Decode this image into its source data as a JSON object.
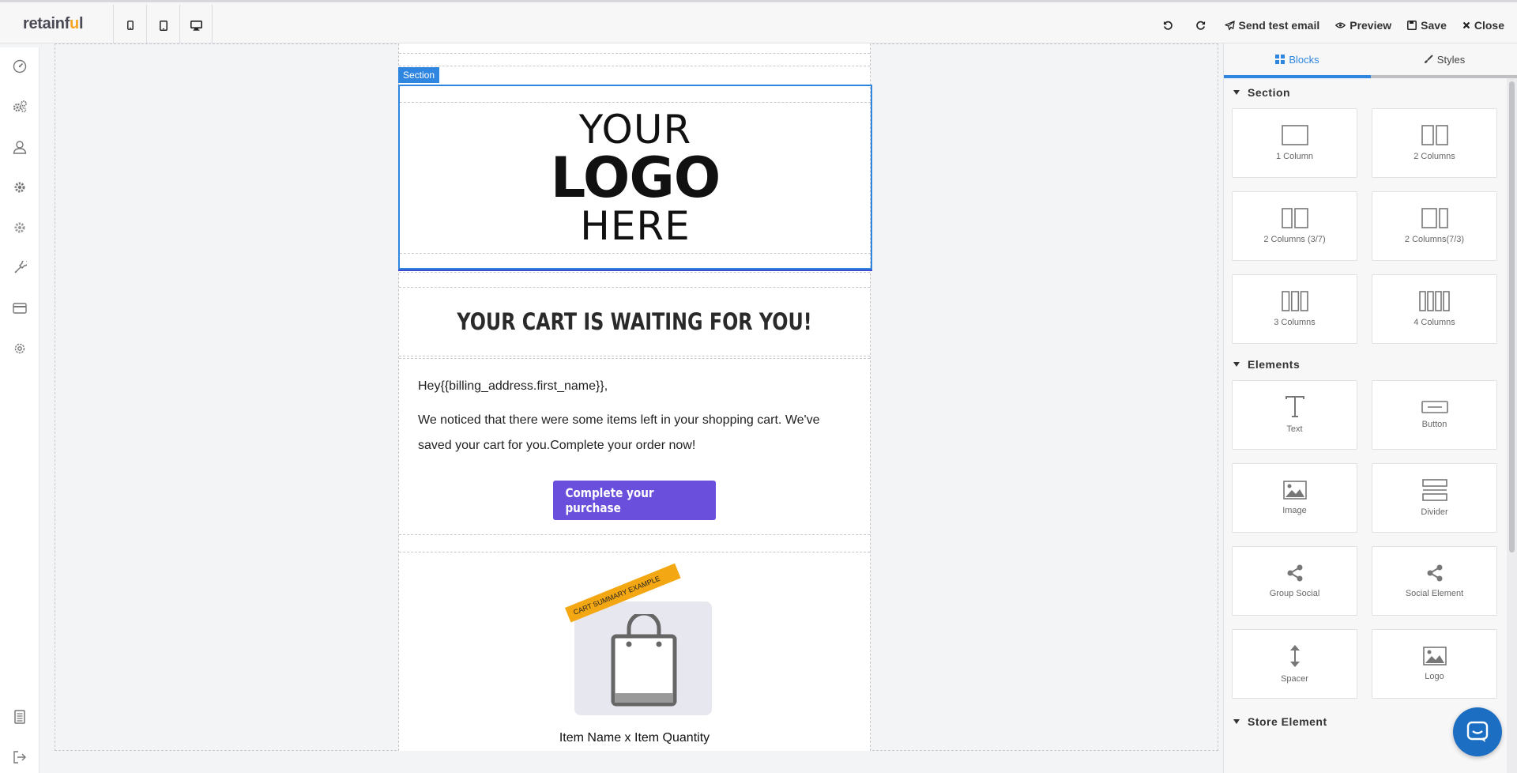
{
  "app": {
    "logo_text_pre": "retainf",
    "logo_text_accent": "u",
    "logo_text_post": "l"
  },
  "toolbar": {
    "devices": [
      "mobile-icon",
      "tablet-icon",
      "desktop-icon"
    ],
    "undo_icon": "undo-icon",
    "redo_icon": "redo-icon",
    "send_test_label": "Send test email",
    "preview_label": "Preview",
    "save_label": "Save",
    "close_label": "Close"
  },
  "sidebar": {
    "items": [
      "dashboard-icon",
      "automation-icon",
      "user-icon",
      "settings-icon",
      "cog-icon",
      "tools-icon",
      "billing-icon",
      "preferences-icon",
      "document-icon",
      "logout-icon"
    ]
  },
  "email": {
    "section_badge": "Section",
    "logo": {
      "line1": "YOUR",
      "line2": "LOGO",
      "line3": "HERE"
    },
    "heading": "YOUR CART IS WAITING FOR YOU!",
    "greeting": "Hey{{billing_address.first_name}},",
    "paragraph": "We noticed that there were some items left in your shopping cart. We've saved your cart for you.Complete your order now!",
    "cta_label": "Complete your purchase",
    "cart_ribbon": "CART SUMMARY EXAMPLE",
    "item_name": "Item Name x Item Quantity"
  },
  "panel": {
    "tabs": [
      {
        "label": "Blocks",
        "icon": "grid-icon",
        "active": true
      },
      {
        "label": "Styles",
        "icon": "brush-icon",
        "active": false
      }
    ],
    "section_title": "Section",
    "section_blocks": [
      {
        "label": "1 Column",
        "icon": "one-column-icon"
      },
      {
        "label": "2 Columns",
        "icon": "two-columns-icon"
      },
      {
        "label": "2 Columns (3/7)",
        "icon": "two-columns-37-icon"
      },
      {
        "label": "2 Columns(7/3)",
        "icon": "two-columns-73-icon"
      },
      {
        "label": "3 Columns",
        "icon": "three-columns-icon"
      },
      {
        "label": "4 Columns",
        "icon": "four-columns-icon"
      }
    ],
    "elements_title": "Elements",
    "element_blocks": [
      {
        "label": "Text",
        "icon": "text-icon"
      },
      {
        "label": "Button",
        "icon": "button-icon"
      },
      {
        "label": "Image",
        "icon": "image-icon"
      },
      {
        "label": "Divider",
        "icon": "divider-icon"
      },
      {
        "label": "Group Social",
        "icon": "share-icon"
      },
      {
        "label": "Social Element",
        "icon": "share-icon"
      },
      {
        "label": "Spacer",
        "icon": "spacer-icon"
      },
      {
        "label": "Logo",
        "icon": "image-icon"
      }
    ],
    "store_title": "Store Element"
  },
  "colors": {
    "accent": "#2f86e0",
    "cta": "#6a4fdc",
    "brand_accent": "#f5a623",
    "ribbon": "#f3a712",
    "chat": "#1b6ec2"
  }
}
